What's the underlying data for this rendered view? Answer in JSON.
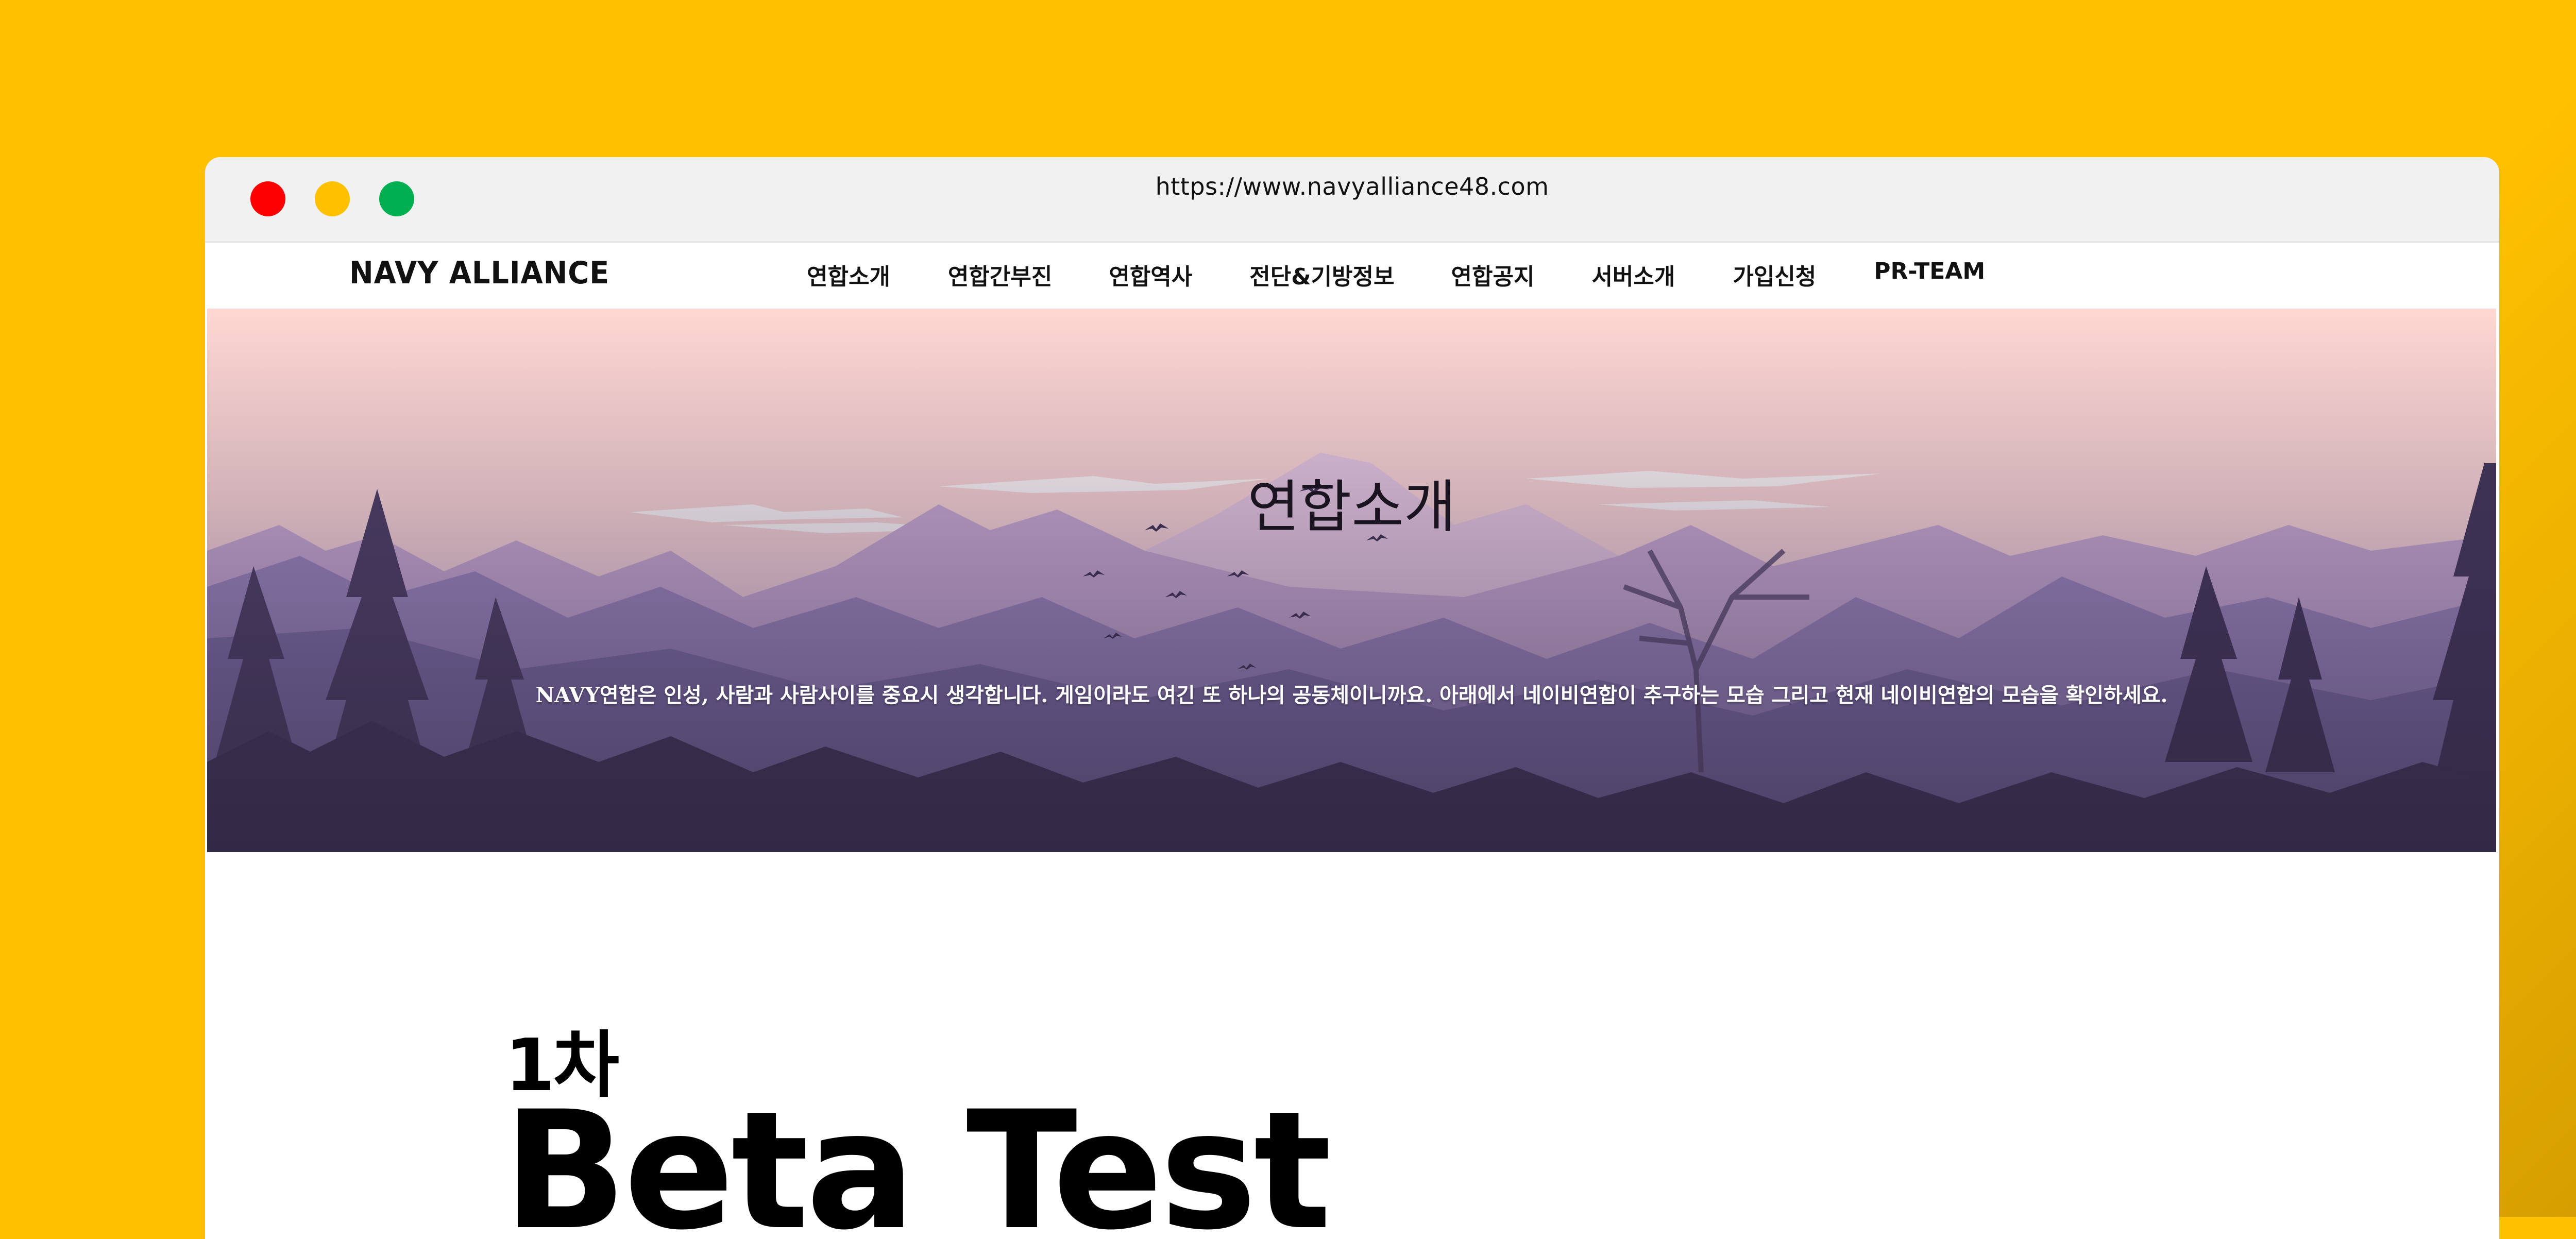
{
  "browser": {
    "url": "https://www.navyalliance48.com",
    "controls": [
      "close",
      "minimize",
      "maximize"
    ]
  },
  "site": {
    "brand": "NAVY ALLIANCE",
    "menu": [
      "연합소개",
      "연합간부진",
      "연합역사",
      "전단&기방정보",
      "연합공지",
      "서버소개",
      "가입신청",
      "PR-TEAM"
    ]
  },
  "hero": {
    "title": "연합소개",
    "description": "NAVY연합은 인성, 사람과 사람사이를 중요시 생각합니다. 게임이라도 여긴 또 하나의 공동체이니까요. 아래에서 네이비연합이 추구하는 모습 그리고 현재 네이비연합의 모습을 확인하세요."
  },
  "overlay": {
    "small": "1차",
    "big": "Beta Test"
  },
  "colors": {
    "background": "#FFC000",
    "close": "#FF0000",
    "minimize": "#FFC000",
    "maximize": "#00B050"
  }
}
